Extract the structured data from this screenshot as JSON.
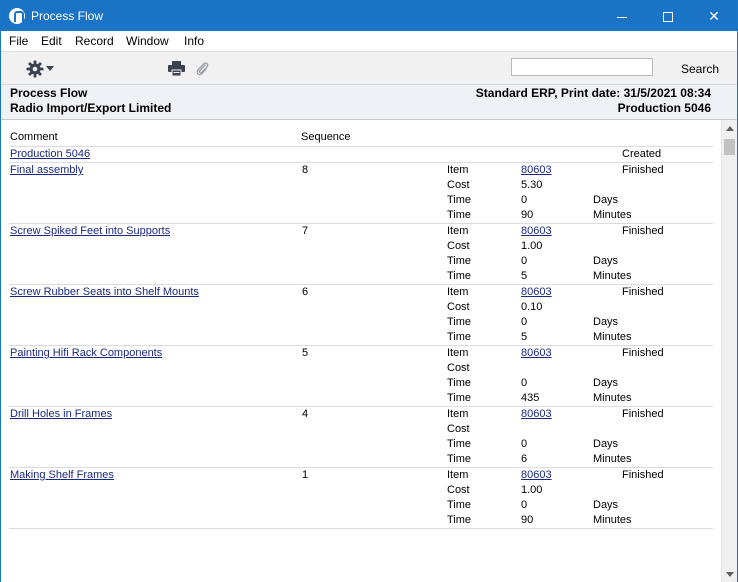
{
  "window": {
    "title": "Process Flow"
  },
  "menu": [
    "File",
    "Edit",
    "Record",
    "Window",
    "Info"
  ],
  "toolbar": {
    "search_placeholder": "",
    "search_label": "Search"
  },
  "report_header": {
    "title": "Process Flow",
    "company": "Radio Import/Export Limited",
    "system_print_date": "Standard ERP, Print date: 31/5/2021 08:34",
    "production": "Production 5046"
  },
  "columns": {
    "comment": "Comment",
    "sequence": "Sequence"
  },
  "top_row": {
    "link": "Production 5046",
    "status": "Created"
  },
  "labels": {
    "item": "Item",
    "cost": "Cost",
    "time": "Time",
    "days": "Days",
    "minutes": "Minutes"
  },
  "steps": [
    {
      "comment": "Final assembly",
      "sequence": "8",
      "item": "80603",
      "cost": "5.30",
      "days": "0",
      "minutes": "90",
      "status": "Finished"
    },
    {
      "comment": "Screw Spiked Feet into Supports",
      "sequence": "7",
      "item": "80603",
      "cost": "1.00",
      "days": "0",
      "minutes": "5",
      "status": "Finished"
    },
    {
      "comment": "Screw Rubber Seats into Shelf Mounts",
      "sequence": "6",
      "item": "80603",
      "cost": "0.10",
      "days": "0",
      "minutes": "5",
      "status": "Finished"
    },
    {
      "comment": "Painting Hifi Rack Components",
      "sequence": "5",
      "item": "80603",
      "cost": "",
      "days": "0",
      "minutes": "435",
      "status": "Finished"
    },
    {
      "comment": "Drill Holes in Frames",
      "sequence": "4",
      "item": "80603",
      "cost": "",
      "days": "0",
      "minutes": "6",
      "status": "Finished"
    },
    {
      "comment": "Making Shelf Frames",
      "sequence": "1",
      "item": "80603",
      "cost": "1.00",
      "days": "0",
      "minutes": "90",
      "status": "Finished"
    }
  ],
  "colors": {
    "titlebar": "#1a73c4",
    "header_bg": "#eef1f6",
    "link": "#1a2a80"
  }
}
